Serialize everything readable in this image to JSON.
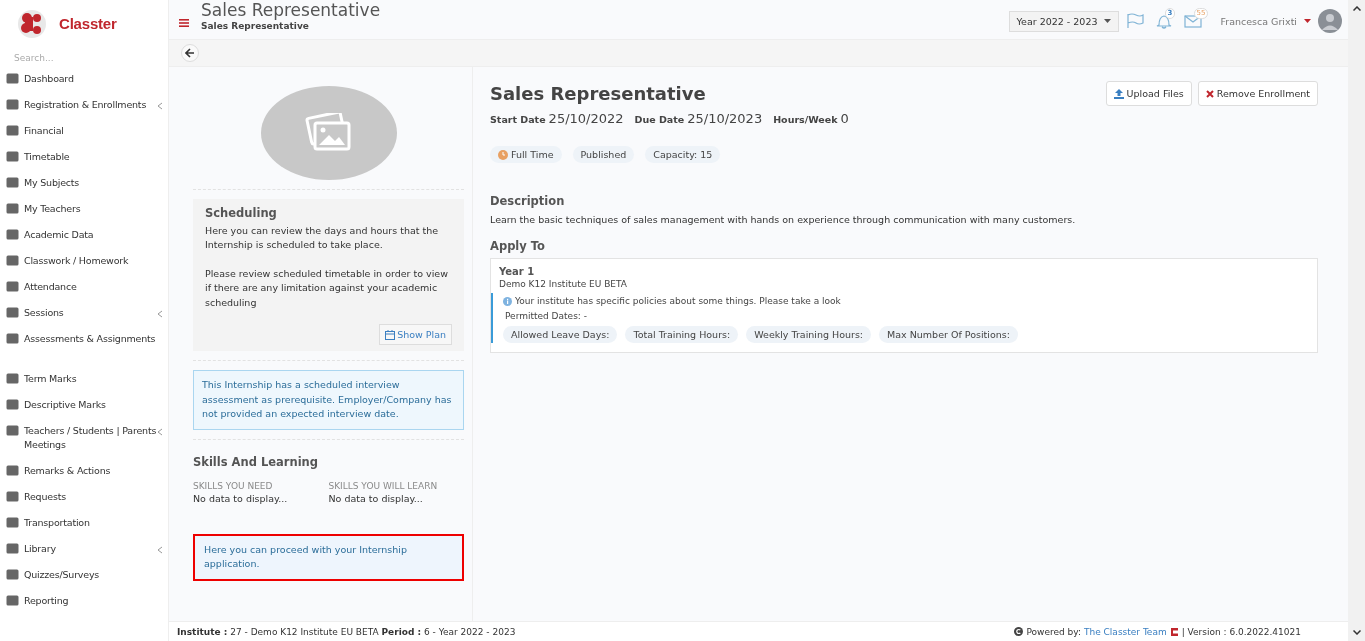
{
  "brand": {
    "name": "Classter"
  },
  "sidebar": {
    "search_placeholder": "Search...",
    "items": [
      {
        "label": "Dashboard",
        "submenu": false
      },
      {
        "label": "Registration & Enrollments",
        "submenu": true
      },
      {
        "label": "Financial",
        "submenu": false
      },
      {
        "label": "Timetable",
        "submenu": false
      },
      {
        "label": "My Subjects",
        "submenu": false
      },
      {
        "label": "My Teachers",
        "submenu": false
      },
      {
        "label": "Academic Data",
        "submenu": false
      },
      {
        "label": "Classwork / Homework",
        "submenu": false
      },
      {
        "label": "Attendance",
        "submenu": false
      },
      {
        "label": "Sessions",
        "submenu": true
      },
      {
        "label": "Assessments & Assignments",
        "submenu": false
      },
      {
        "label": "Term Marks",
        "submenu": false
      },
      {
        "label": "Descriptive Marks",
        "submenu": false
      },
      {
        "label": "Teachers / Students | Parents Meetings",
        "submenu": true
      },
      {
        "label": "Remarks & Actions",
        "submenu": false
      },
      {
        "label": "Requests",
        "submenu": false
      },
      {
        "label": "Transportation",
        "submenu": false
      },
      {
        "label": "Library",
        "submenu": true
      },
      {
        "label": "Quizzes/Surveys",
        "submenu": false
      },
      {
        "label": "Reporting",
        "submenu": false
      }
    ]
  },
  "header": {
    "title": "Sales Representative",
    "subtitle": "Sales Representative",
    "year": "Year 2022 - 2023",
    "notifications": "3",
    "messages": "55",
    "user": "Francesca Grixti"
  },
  "left_panel": {
    "scheduling": {
      "title": "Scheduling",
      "paragraphs": [
        "Here you can review the days and hours that the Internship is scheduled to take place.",
        "Please review scheduled timetable in order to view if there are any limitation against your academic scheduling"
      ],
      "button": "Show Plan"
    },
    "interview_notice": "This Internship has a scheduled interview assessment as prerequisite. Employer/Company has not provided an expected interview date.",
    "skills": {
      "title": "Skills And Learning",
      "columns": [
        {
          "heading": "SKILLS YOU NEED",
          "value": "No data to display..."
        },
        {
          "heading": "SKILLS YOU WILL LEARN",
          "value": "No data to display..."
        }
      ]
    },
    "proceed_notice": {
      "text": "Here you can proceed with your Internship application.",
      "highlighted": true
    }
  },
  "detail": {
    "title": "Sales Representative",
    "buttons": [
      {
        "label": "Upload Files",
        "kind": "upload"
      },
      {
        "label": "Remove Enrollment",
        "kind": "remove"
      }
    ],
    "facts": [
      {
        "label": "Start Date",
        "value": "25/10/2022"
      },
      {
        "label": "Due Date",
        "value": "25/10/2023"
      },
      {
        "label": "Hours/Week",
        "value": "0"
      }
    ],
    "tags": [
      {
        "label": "Full Time",
        "kind": "clock"
      },
      {
        "label": "Published",
        "kind": "plain"
      },
      {
        "label": "Capacity: 15",
        "kind": "plain"
      }
    ],
    "description_title": "Description",
    "description": "Learn the basic techniques of sales management with hands on experience through communication with many customers.",
    "apply_title": "Apply To",
    "apply": {
      "year": "Year 1",
      "institute": "Demo K12 Institute EU BETA",
      "policy_note": "Your institute has specific policies about some things. Please take a look",
      "permitted_dates": "Permitted Dates: -",
      "policies": [
        "Allowed Leave Days:",
        "Total Training Hours:",
        "Weekly Training Hours:",
        "Max Number Of Positions:"
      ]
    }
  },
  "status_bar": {
    "left": "**Institute :** 27 - Demo K12 Institute EU BETA **Period :** 6 - Year 2022 - 2023",
    "powered": "Powered by:",
    "team_link": "The Classter Team",
    "version": "| Version : 6.0.2022.41021"
  }
}
